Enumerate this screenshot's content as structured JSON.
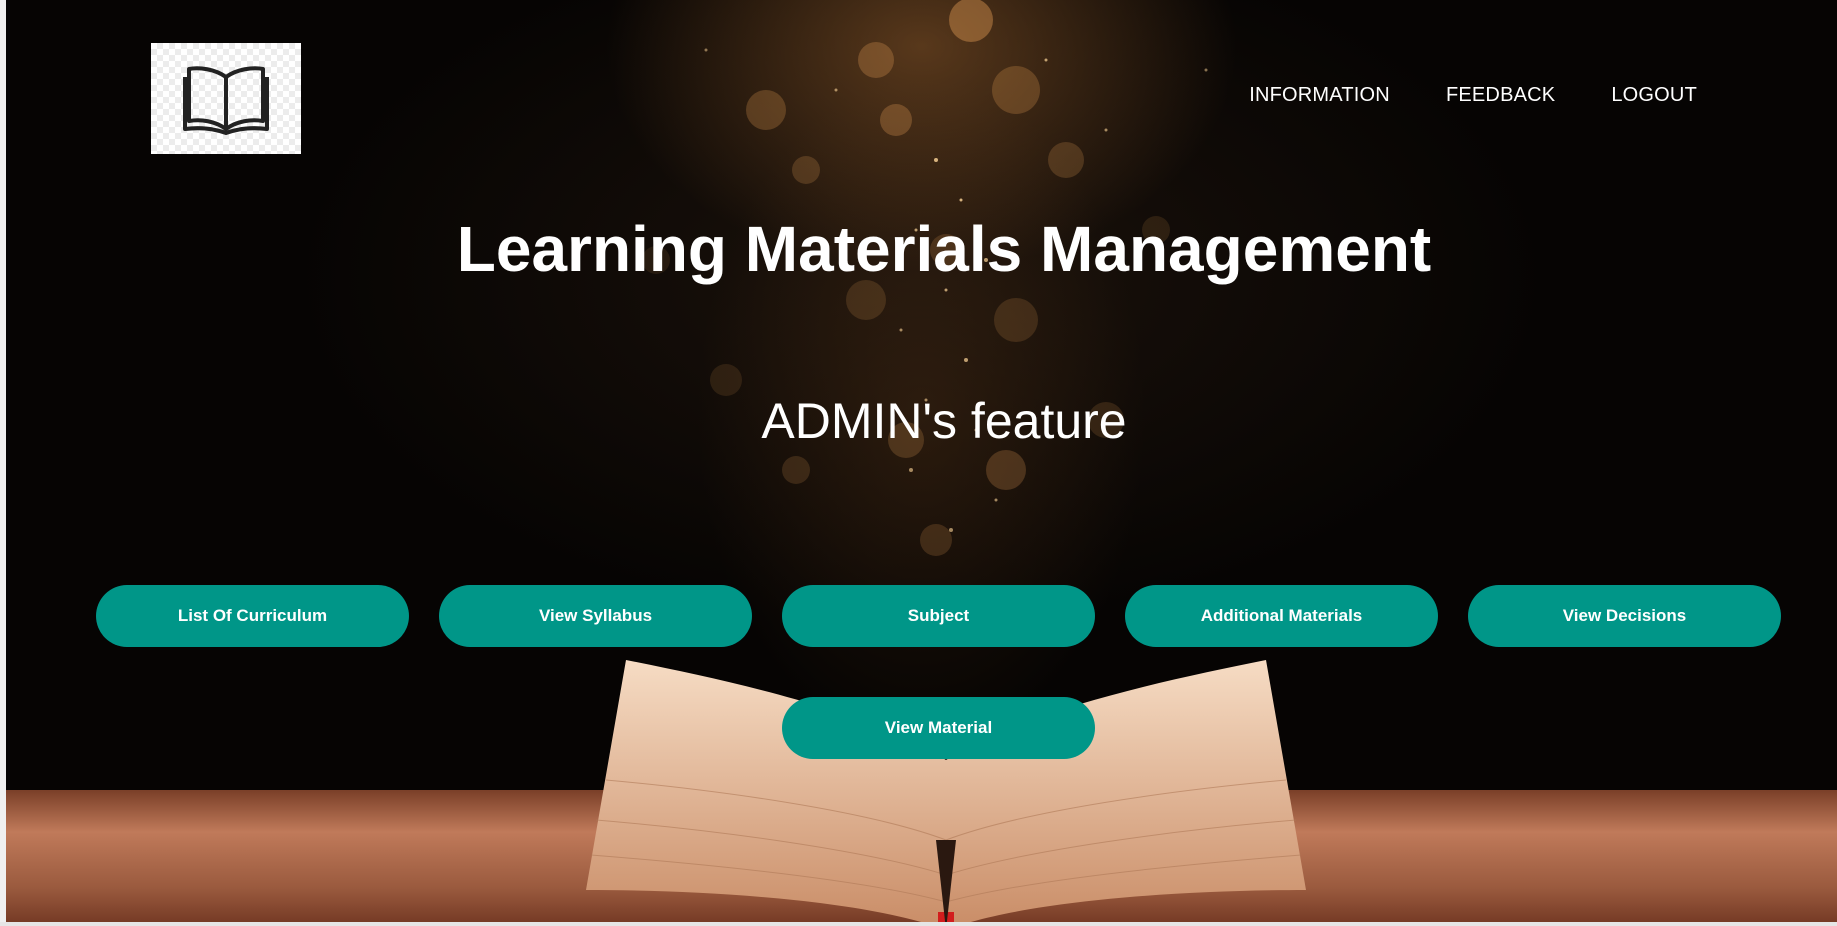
{
  "header": {
    "logo_icon": "open-book-icon",
    "nav": [
      "INFORMATION",
      "FEEDBACK",
      "LOGOUT"
    ]
  },
  "main": {
    "title": "Learning Materials Management",
    "subtitle": "ADMIN's feature",
    "buttons": [
      "List Of Curriculum",
      "View Syllabus",
      "Subject",
      "Additional Materials",
      "View Decisions",
      "View Material"
    ]
  },
  "colors": {
    "button_bg": "#009688",
    "text": "#ffffff",
    "background": "#0a0604"
  }
}
